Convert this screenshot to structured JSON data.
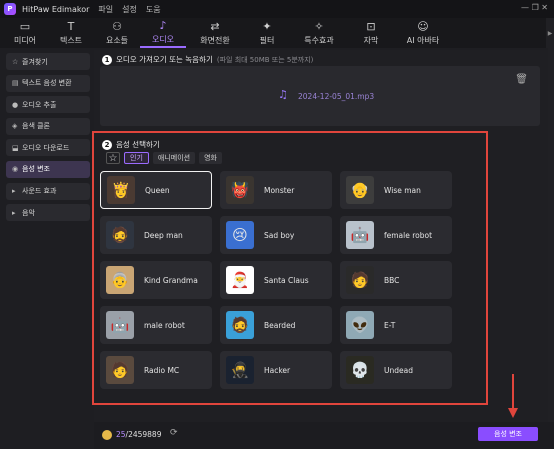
{
  "app": {
    "title": "HitPaw Edimakor",
    "logo_letter": "P",
    "menu": [
      "파일",
      "설정",
      "도움"
    ],
    "window_controls": "— ❐ ✕"
  },
  "toolbar": [
    {
      "label": "미디어",
      "icon": "media-icon",
      "glyph": "▭"
    },
    {
      "label": "텍스트",
      "icon": "text-icon",
      "glyph": "T"
    },
    {
      "label": "요소들",
      "icon": "elements-icon",
      "glyph": "⚇"
    },
    {
      "label": "오디오",
      "icon": "music-note-icon",
      "glyph": "♪"
    },
    {
      "label": "화면전환",
      "icon": "transition-icon",
      "glyph": "⇄"
    },
    {
      "label": "필터",
      "icon": "filter-icon",
      "glyph": "✦"
    },
    {
      "label": "특수효과",
      "icon": "effects-icon",
      "glyph": "✧"
    },
    {
      "label": "자막",
      "icon": "subtitle-icon",
      "glyph": "⊡"
    },
    {
      "label": "AI 아바타",
      "icon": "ai-avatar-icon",
      "glyph": "☺"
    }
  ],
  "sidebar": [
    {
      "label": "즐겨찾기",
      "icon": "star-icon",
      "glyph": "☆"
    },
    {
      "label": "텍스트 음성 변환",
      "icon": "text-to-speech-icon",
      "glyph": "▤"
    },
    {
      "label": "오디오 추출",
      "icon": "microphone-icon",
      "glyph": "●"
    },
    {
      "label": "음색 클론",
      "icon": "clone-icon",
      "glyph": "◈"
    },
    {
      "label": "오디오 다운로드",
      "icon": "download-icon",
      "glyph": "⬓"
    },
    {
      "label": "음성 변조",
      "icon": "voice-changer-icon",
      "glyph": "◉",
      "active": true
    },
    {
      "label": "사운드 효과",
      "icon": "expand-arrow-icon",
      "glyph": "▸"
    },
    {
      "label": "음악",
      "icon": "expand-arrow-icon",
      "glyph": "▸"
    }
  ],
  "step1": {
    "number": "1",
    "title": "오디오 가져오기 또는 녹음하기",
    "hint": "(파일 최대 50MB 또는 5분까지)",
    "file_name": "2024-12-05_01.mp3"
  },
  "step2": {
    "number": "2",
    "title": "음성 선택하기",
    "tabs": [
      "인기",
      "애니메이션",
      "영화"
    ],
    "active_tab": "인기"
  },
  "voices": [
    {
      "label": "Queen",
      "avatar": "queen-avatar",
      "emoji": "👸",
      "bg": "#4a3a32",
      "selected": true
    },
    {
      "label": "Monster",
      "avatar": "monster-avatar",
      "emoji": "👹",
      "bg": "#3a3530"
    },
    {
      "label": "Wise man",
      "avatar": "wise-man-avatar",
      "emoji": "👴",
      "bg": "#3d3d3d"
    },
    {
      "label": "Deep man",
      "avatar": "deep-man-avatar",
      "emoji": "🧔",
      "bg": "#2f3540"
    },
    {
      "label": "Sad boy",
      "avatar": "sad-boy-avatar",
      "emoji": "😢",
      "bg": "#3a6fd0"
    },
    {
      "label": "female robot",
      "avatar": "female-robot-avatar",
      "emoji": "🤖",
      "bg": "#b9c2cc"
    },
    {
      "label": "Kind Grandma",
      "avatar": "kind-grandma-avatar",
      "emoji": "👵",
      "bg": "#c9a574"
    },
    {
      "label": "Santa Claus",
      "avatar": "santa-claus-avatar",
      "emoji": "🎅",
      "bg": "#ffffff"
    },
    {
      "label": "BBC",
      "avatar": "bbc-avatar",
      "emoji": "🧑",
      "bg": "#2a2a2a"
    },
    {
      "label": "male robot",
      "avatar": "male-robot-avatar",
      "emoji": "🤖",
      "bg": "#9aa0a8"
    },
    {
      "label": "Bearded",
      "avatar": "bearded-avatar",
      "emoji": "🧔",
      "bg": "#3aa0d8"
    },
    {
      "label": "E-T",
      "avatar": "et-avatar",
      "emoji": "👽",
      "bg": "#8fa9b5"
    },
    {
      "label": "Radio MC",
      "avatar": "radio-mc-avatar",
      "emoji": "🧑",
      "bg": "#5a4a3e"
    },
    {
      "label": "Hacker",
      "avatar": "hacker-avatar",
      "emoji": "🥷",
      "bg": "#1a2230"
    },
    {
      "label": "Undead",
      "avatar": "undead-avatar",
      "emoji": "💀",
      "bg": "#2a2a22"
    }
  ],
  "footer": {
    "credits_used": "25",
    "credits_total": "/2459889",
    "convert_button": "음성 변조"
  },
  "colors": {
    "accent": "#8a4dff",
    "highlight_frame": "#e0453c"
  }
}
